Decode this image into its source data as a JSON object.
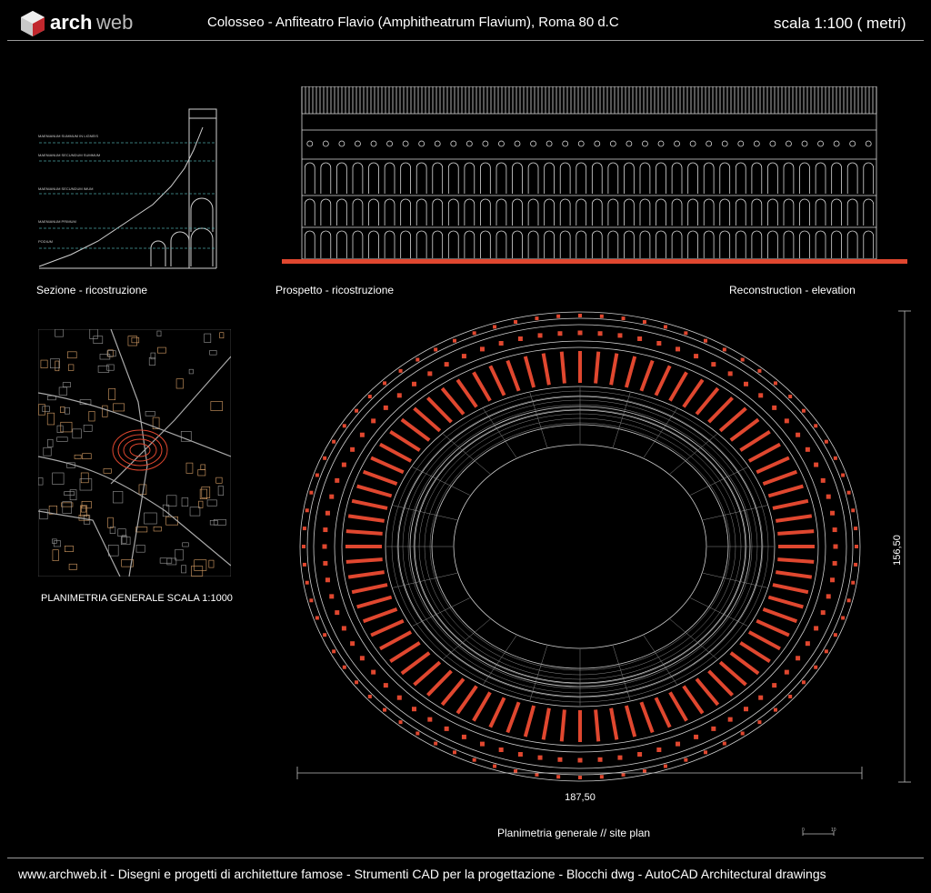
{
  "header": {
    "logo_text_a": "arch",
    "logo_text_b": "web",
    "title": "Colosseo -  Anfiteatro Flavio (Amphitheatrum Flavium),  Roma  80 d.C",
    "scale": "scala 1:100 ( metri)"
  },
  "captions": {
    "section": "Sezione - ricostruzione",
    "elevation_it": "Prospetto - ricostruzione",
    "elevation_en": "Reconstruction - elevation",
    "site_plan_small": "PLANIMETRIA GENERALE SCALA 1:1000",
    "plan": "Planimetria generale  //  site plan"
  },
  "section_levels": [
    "MAENIANUM SUMMUM IN LIGNEIS",
    "MAENIANUM SECUNDUM SUMMUM",
    "MAENIANUM SECUNDUM IMUM",
    "MAENIANUM PRIMUM",
    "PODIUM"
  ],
  "dimensions": {
    "width": "187,50",
    "height": "156,50",
    "scalebar_start": "0",
    "scalebar_end": "10"
  },
  "footer": {
    "text": "www.archweb.it -    Disegni e progetti di architetture famose - Strumenti CAD  per la progettazione - Blocchi dwg - AutoCAD Architectural drawings"
  },
  "colors": {
    "accent_red": "#e0472f",
    "line_grey": "#bdbdbd",
    "orange_blocks": "#d9a066"
  }
}
